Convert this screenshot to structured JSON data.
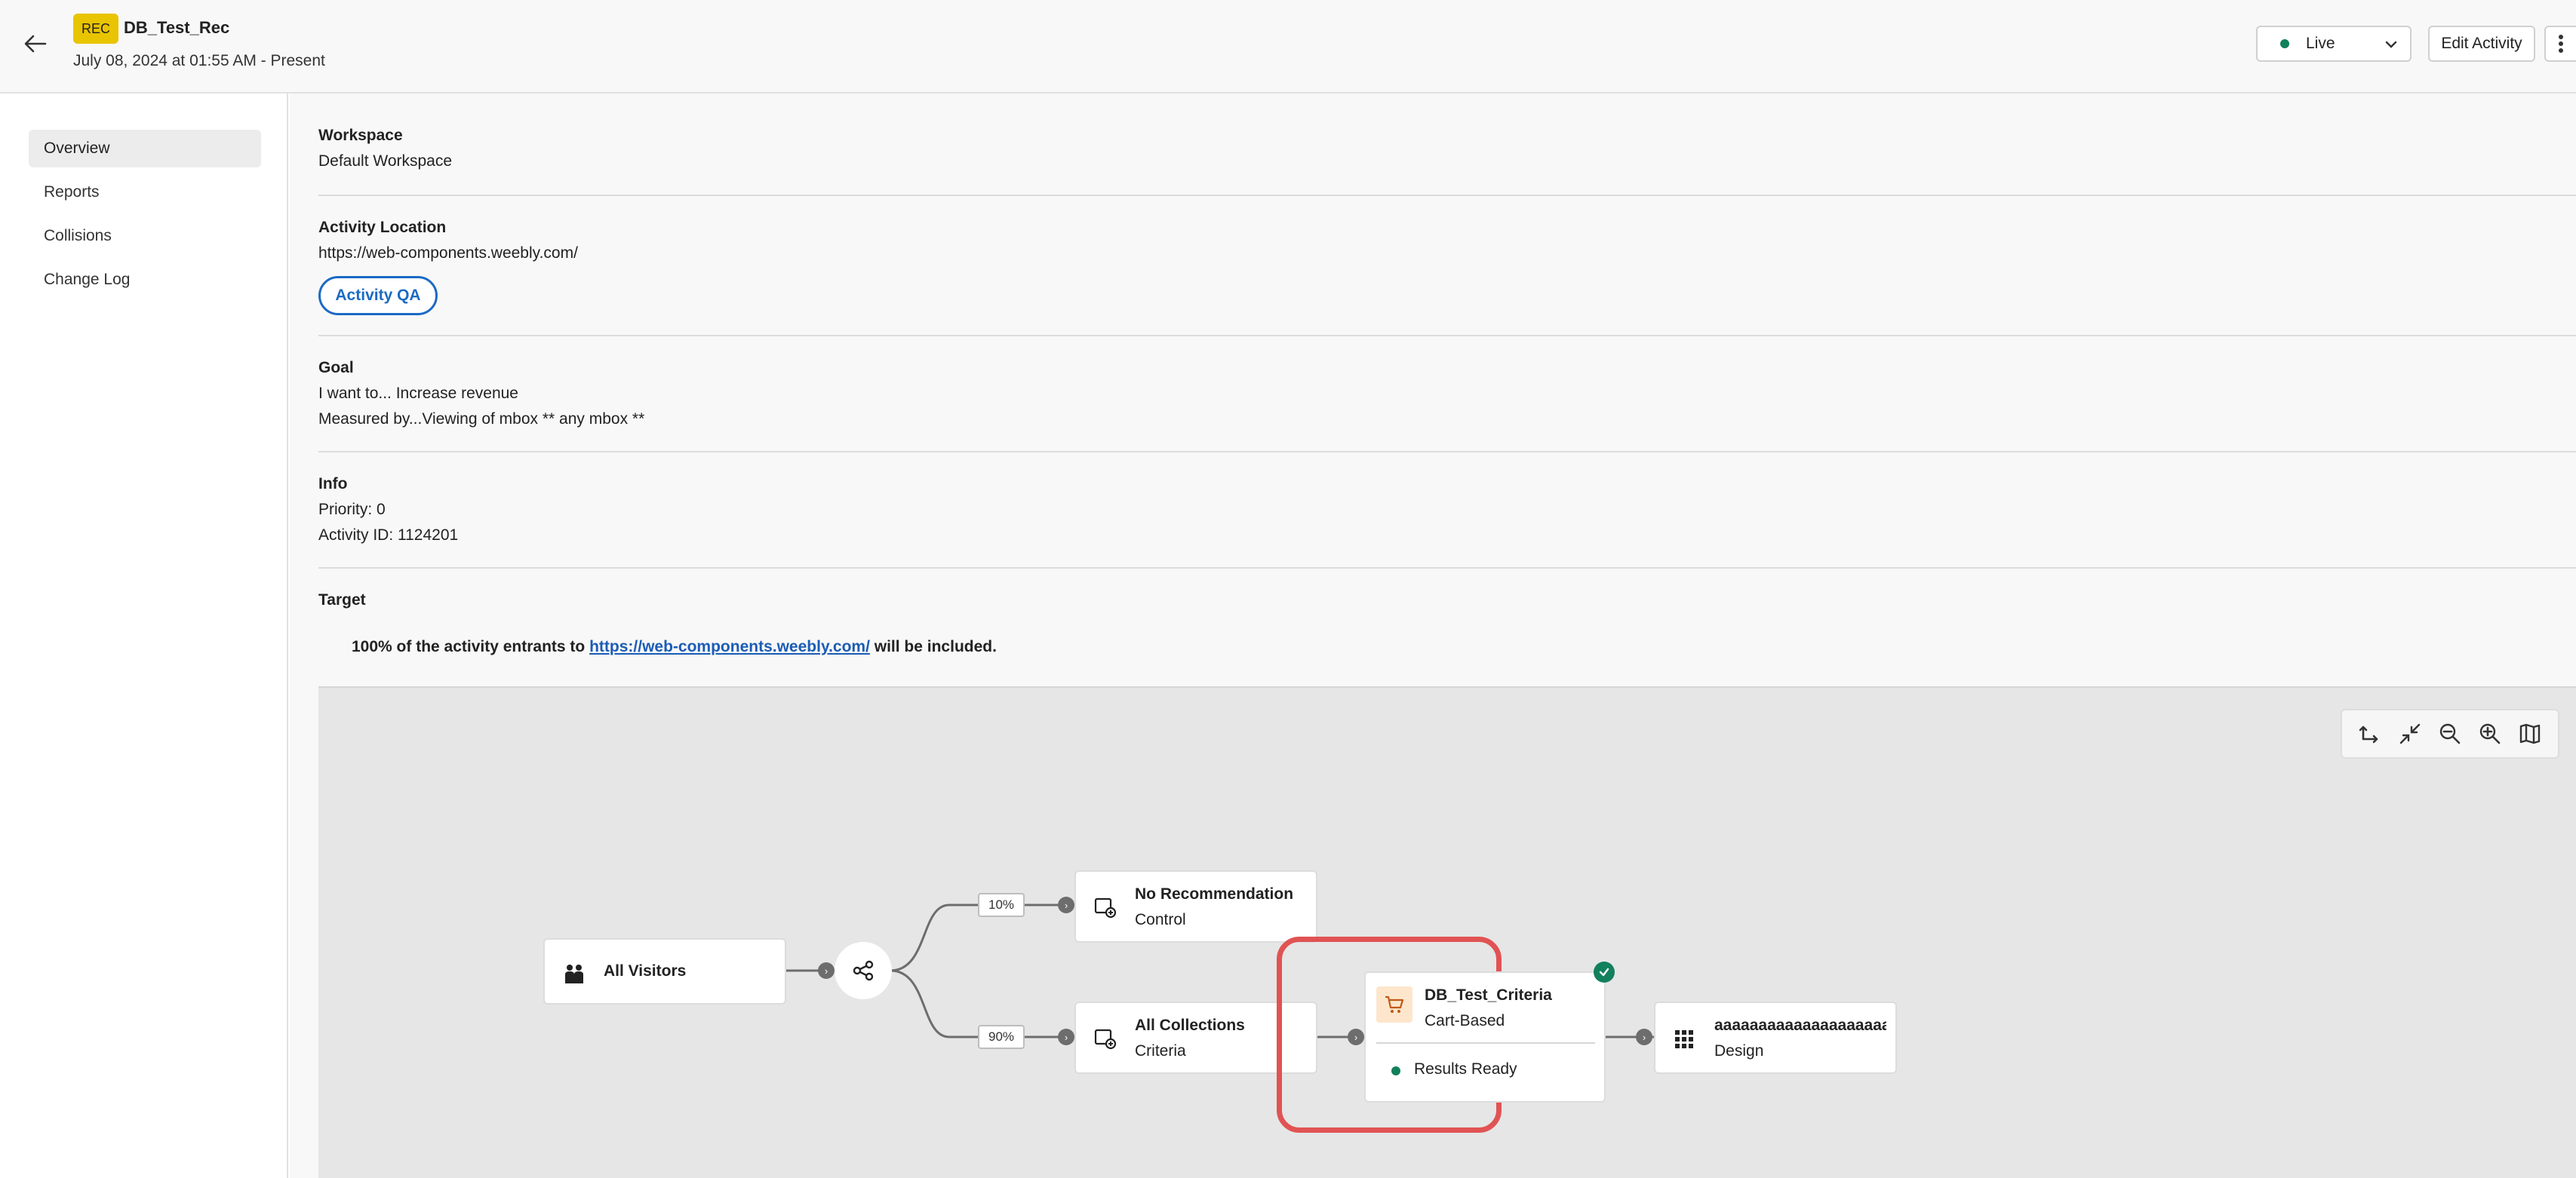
{
  "header": {
    "badge": "REC",
    "title": "DB_Test_Rec",
    "date": "July 08, 2024 at 01:55 AM - Present",
    "status": "Live",
    "edit_label": "Edit Activity"
  },
  "sidebar": {
    "items": [
      {
        "label": "Overview",
        "active": true
      },
      {
        "label": "Reports"
      },
      {
        "label": "Collisions"
      },
      {
        "label": "Change Log"
      }
    ]
  },
  "sections": {
    "workspace": {
      "label": "Workspace",
      "value": "Default Workspace"
    },
    "location": {
      "label": "Activity Location",
      "value": "https://web-components.weebly.com/",
      "qa_button": "Activity QA"
    },
    "goal": {
      "label": "Goal",
      "line1": "I want to... Increase revenue",
      "line2": "Measured by...Viewing of mbox ** any mbox **"
    },
    "info": {
      "label": "Info",
      "priority": "Priority: 0",
      "activity_id": "Activity ID: 1124201"
    },
    "target": {
      "label": "Target",
      "text_before": "100% of the activity entrants to ",
      "link": "https://web-components.weebly.com/",
      "text_after": " will be included."
    }
  },
  "flow": {
    "audience": {
      "title": "All Visitors"
    },
    "split_pcts": [
      "10%",
      "90%"
    ],
    "experience_a": {
      "title": "No Recommendation",
      "sub": "Control"
    },
    "experience_b": {
      "title": "All Collections",
      "sub": "Criteria"
    },
    "criteria": {
      "title": "DB_Test_Criteria",
      "sub": "Cart-Based",
      "status": "Results Ready"
    },
    "design": {
      "title": "aaaaaaaaaaaaaaaaaaaa",
      "sub": "Design"
    }
  },
  "colors": {
    "rec_badge": "#e9c400",
    "live_dot": "#12805c",
    "link": "#1b5cb5",
    "highlight": "#e15353"
  },
  "icons": [
    "back-arrow-icon",
    "chevron-down-icon",
    "more-vertical-icon",
    "flip-icon",
    "collapse-icon",
    "zoom-out-icon",
    "zoom-in-icon",
    "map-icon",
    "people-icon",
    "share-icon",
    "add-experience-icon",
    "cart-icon",
    "check-circle-icon",
    "grid-icon"
  ]
}
